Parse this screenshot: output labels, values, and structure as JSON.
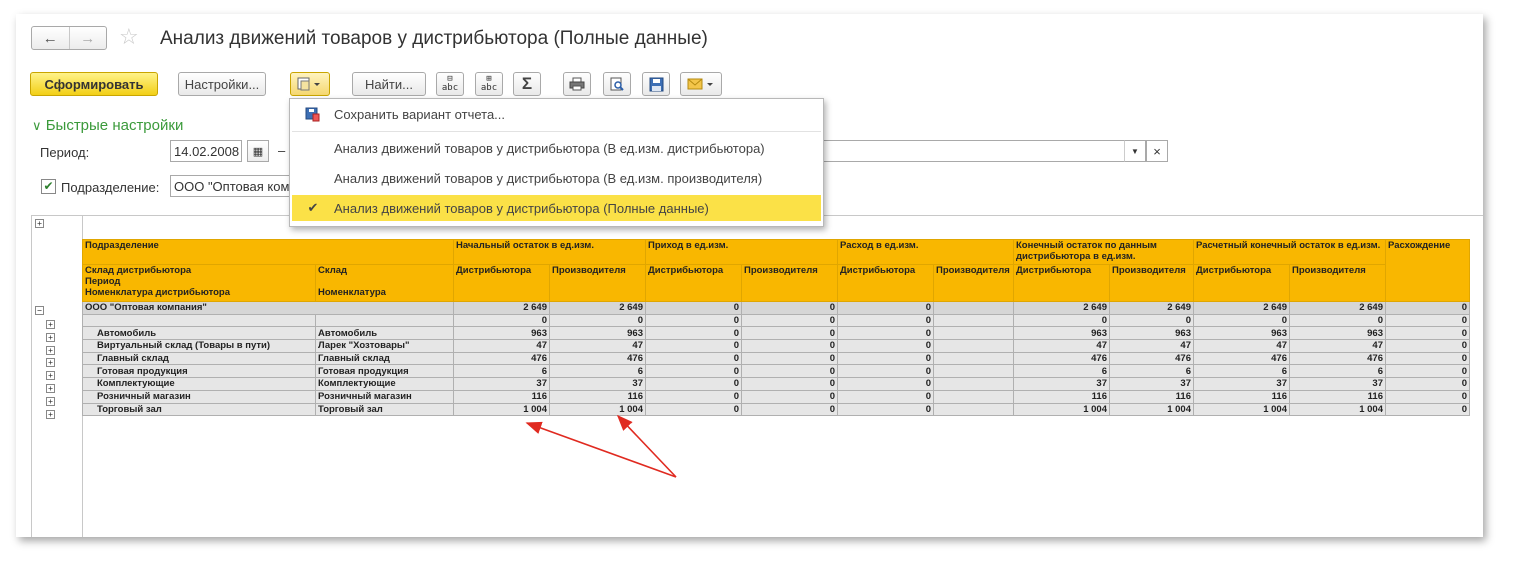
{
  "window": {
    "title": "Анализ движений товаров у дистрибьютора (Полные данные)",
    "nav_back": "←",
    "nav_forward": "→"
  },
  "toolbar": {
    "generate_label": "Сформировать",
    "settings_label": "Настройки...",
    "find_label": "Найти...",
    "sum_label": "Σ"
  },
  "quick_settings": {
    "header": "Быстрые настройки",
    "period_label": "Период:",
    "period_from": "14.02.2008",
    "period_dash": "–",
    "division_label": "Подразделение:",
    "division_value": "ООО \"Оптовая комп",
    "clear_symbol": "×"
  },
  "variant_menu": {
    "items": [
      {
        "label": "Сохранить вариант отчета...",
        "icon": "save-variant-icon"
      },
      {
        "label": "Анализ движений товаров у дистрибьютора (В ед.изм. дистрибьютора)"
      },
      {
        "label": "Анализ движений товаров у дистрибьютора (В ед.изм. производителя)"
      },
      {
        "label": "Анализ движений товаров у дистрибьютора (Полные данные)",
        "checked": true
      }
    ]
  },
  "report": {
    "headers": {
      "division": "Подразделение",
      "opening": "Начальный остаток в ед.изм.",
      "receipt": "Приход в ед.изм.",
      "expense": "Расход в ед.изм.",
      "closing": "Конечный остаток по данным дистрибьютора в ед.изм.",
      "calc_closing": "Расчетный конечный остаток в ед.изм.",
      "difference": "Расхождение",
      "warehouse_dist": "Склад дистрибьютора",
      "period": "Период",
      "nomenclature_dist": "Номенклатура дистрибьютора",
      "warehouse": "Склад",
      "nomenclature": "Номенклатура",
      "distributor": "Дистрибьютора",
      "producer": "Производителя"
    },
    "group": {
      "name": "ООО \"Оптовая компания\"",
      "values": [
        "2 649",
        "2 649",
        "0",
        "0",
        "0",
        "",
        "2 649",
        "2 649",
        "2 649",
        "2 649",
        "0"
      ]
    },
    "rows": [
      {
        "wh_dist": "",
        "wh": "",
        "values": [
          "0",
          "0",
          "0",
          "0",
          "0",
          "",
          "0",
          "0",
          "0",
          "0",
          "0"
        ]
      },
      {
        "wh_dist": "Автомобиль",
        "wh": "Автомобиль",
        "values": [
          "963",
          "963",
          "0",
          "0",
          "0",
          "",
          "963",
          "963",
          "963",
          "963",
          "0"
        ]
      },
      {
        "wh_dist": "Виртуальный склад (Товары в пути)",
        "wh": "Ларек \"Хозтовары\"",
        "values": [
          "47",
          "47",
          "0",
          "0",
          "0",
          "",
          "47",
          "47",
          "47",
          "47",
          "0"
        ]
      },
      {
        "wh_dist": "Главный склад",
        "wh": "Главный склад",
        "values": [
          "476",
          "476",
          "0",
          "0",
          "0",
          "",
          "476",
          "476",
          "476",
          "476",
          "0"
        ]
      },
      {
        "wh_dist": "Готовая продукция",
        "wh": "Готовая продукция",
        "values": [
          "6",
          "6",
          "0",
          "0",
          "0",
          "",
          "6",
          "6",
          "6",
          "6",
          "0"
        ]
      },
      {
        "wh_dist": "Комплектующие",
        "wh": "Комплектующие",
        "values": [
          "37",
          "37",
          "0",
          "0",
          "0",
          "",
          "37",
          "37",
          "37",
          "37",
          "0"
        ]
      },
      {
        "wh_dist": "Розничный магазин",
        "wh": "Розничный магазин",
        "values": [
          "116",
          "116",
          "0",
          "0",
          "0",
          "",
          "116",
          "116",
          "116",
          "116",
          "0"
        ]
      },
      {
        "wh_dist": "Торговый зал",
        "wh": "Торговый зал",
        "values": [
          "1 004",
          "1 004",
          "0",
          "0",
          "0",
          "",
          "1 004",
          "1 004",
          "1 004",
          "1 004",
          "0"
        ]
      }
    ]
  },
  "colors": {
    "header_bg": "#f9b700",
    "accent_green": "#3b9a3b",
    "annotation_red": "#e02a20",
    "active_menu": "#fbe147"
  }
}
